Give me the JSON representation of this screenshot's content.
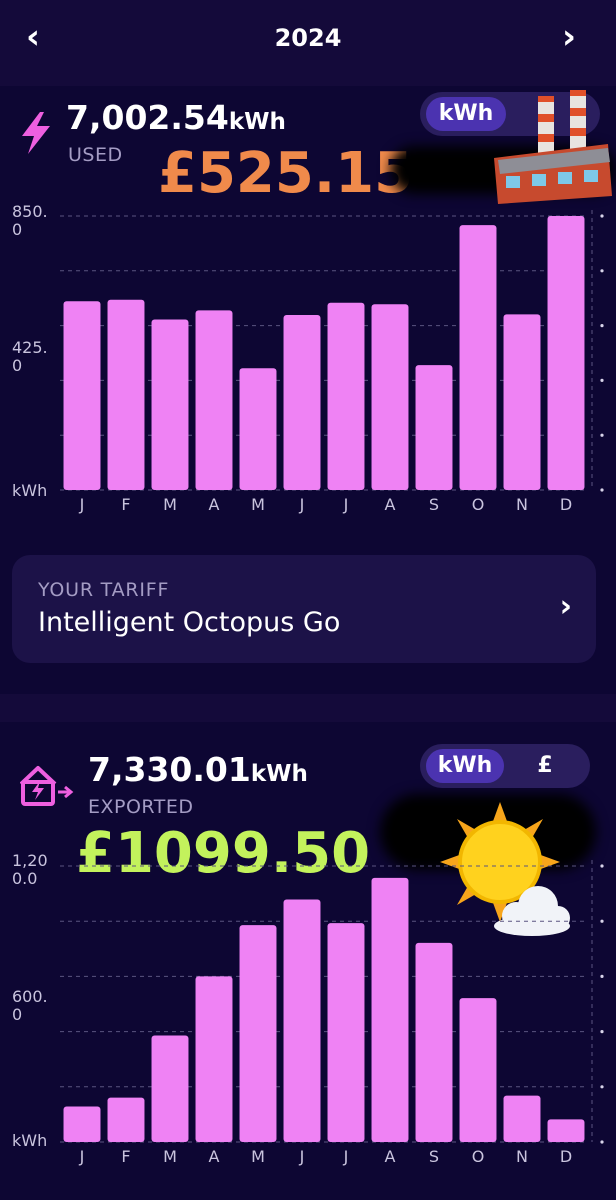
{
  "header": {
    "year": "2024",
    "prev_icon": "chevron-left-icon",
    "next_icon": "chevron-right-icon"
  },
  "used": {
    "value": "7,002.54",
    "unit": "kWh",
    "label": "USED",
    "cost": "£525.15",
    "toggle_active": "kWh",
    "icon": "lightning-icon",
    "decoration": "factory-emoji"
  },
  "exported": {
    "value": "7,330.01",
    "unit": "kWh",
    "label": "EXPORTED",
    "earned": "£1099.50",
    "toggle_active": "kWh",
    "toggle_other": "£",
    "icon": "house-export-icon",
    "decoration": "sun-behind-cloud-emoji"
  },
  "tariff": {
    "label": "YOUR TARIFF",
    "name": "Intelligent Octopus Go"
  },
  "colors": {
    "bar": "#ef82f4",
    "background": "#140a3a",
    "panel": "#0d0633",
    "cost": "#f08a4b",
    "earned": "#c3f25c",
    "toggle_active": "#4b33b0"
  },
  "chart_data": [
    {
      "type": "bar",
      "categories": [
        "J",
        "F",
        "M",
        "A",
        "M",
        "J",
        "J",
        "A",
        "S",
        "O",
        "N",
        "D"
      ],
      "values": [
        620,
        625,
        560,
        590,
        400,
        575,
        615,
        610,
        410,
        870,
        577,
        900
      ],
      "ylabel": "kWh",
      "ytick_labels": [
        "850.\n0",
        "425.\n0",
        "kWh"
      ],
      "ylim": [
        0,
        900
      ],
      "grid": true
    },
    {
      "type": "bar",
      "categories": [
        "J",
        "F",
        "M",
        "A",
        "M",
        "J",
        "J",
        "A",
        "S",
        "O",
        "N",
        "D"
      ],
      "values": [
        180,
        225,
        540,
        840,
        1100,
        1230,
        1110,
        1340,
        1010,
        730,
        235,
        115
      ],
      "ylabel": "kWh",
      "ytick_labels": [
        "1,20\n0.0",
        "600.\n0",
        "kWh"
      ],
      "ylim": [
        0,
        1400
      ],
      "grid": true
    }
  ]
}
